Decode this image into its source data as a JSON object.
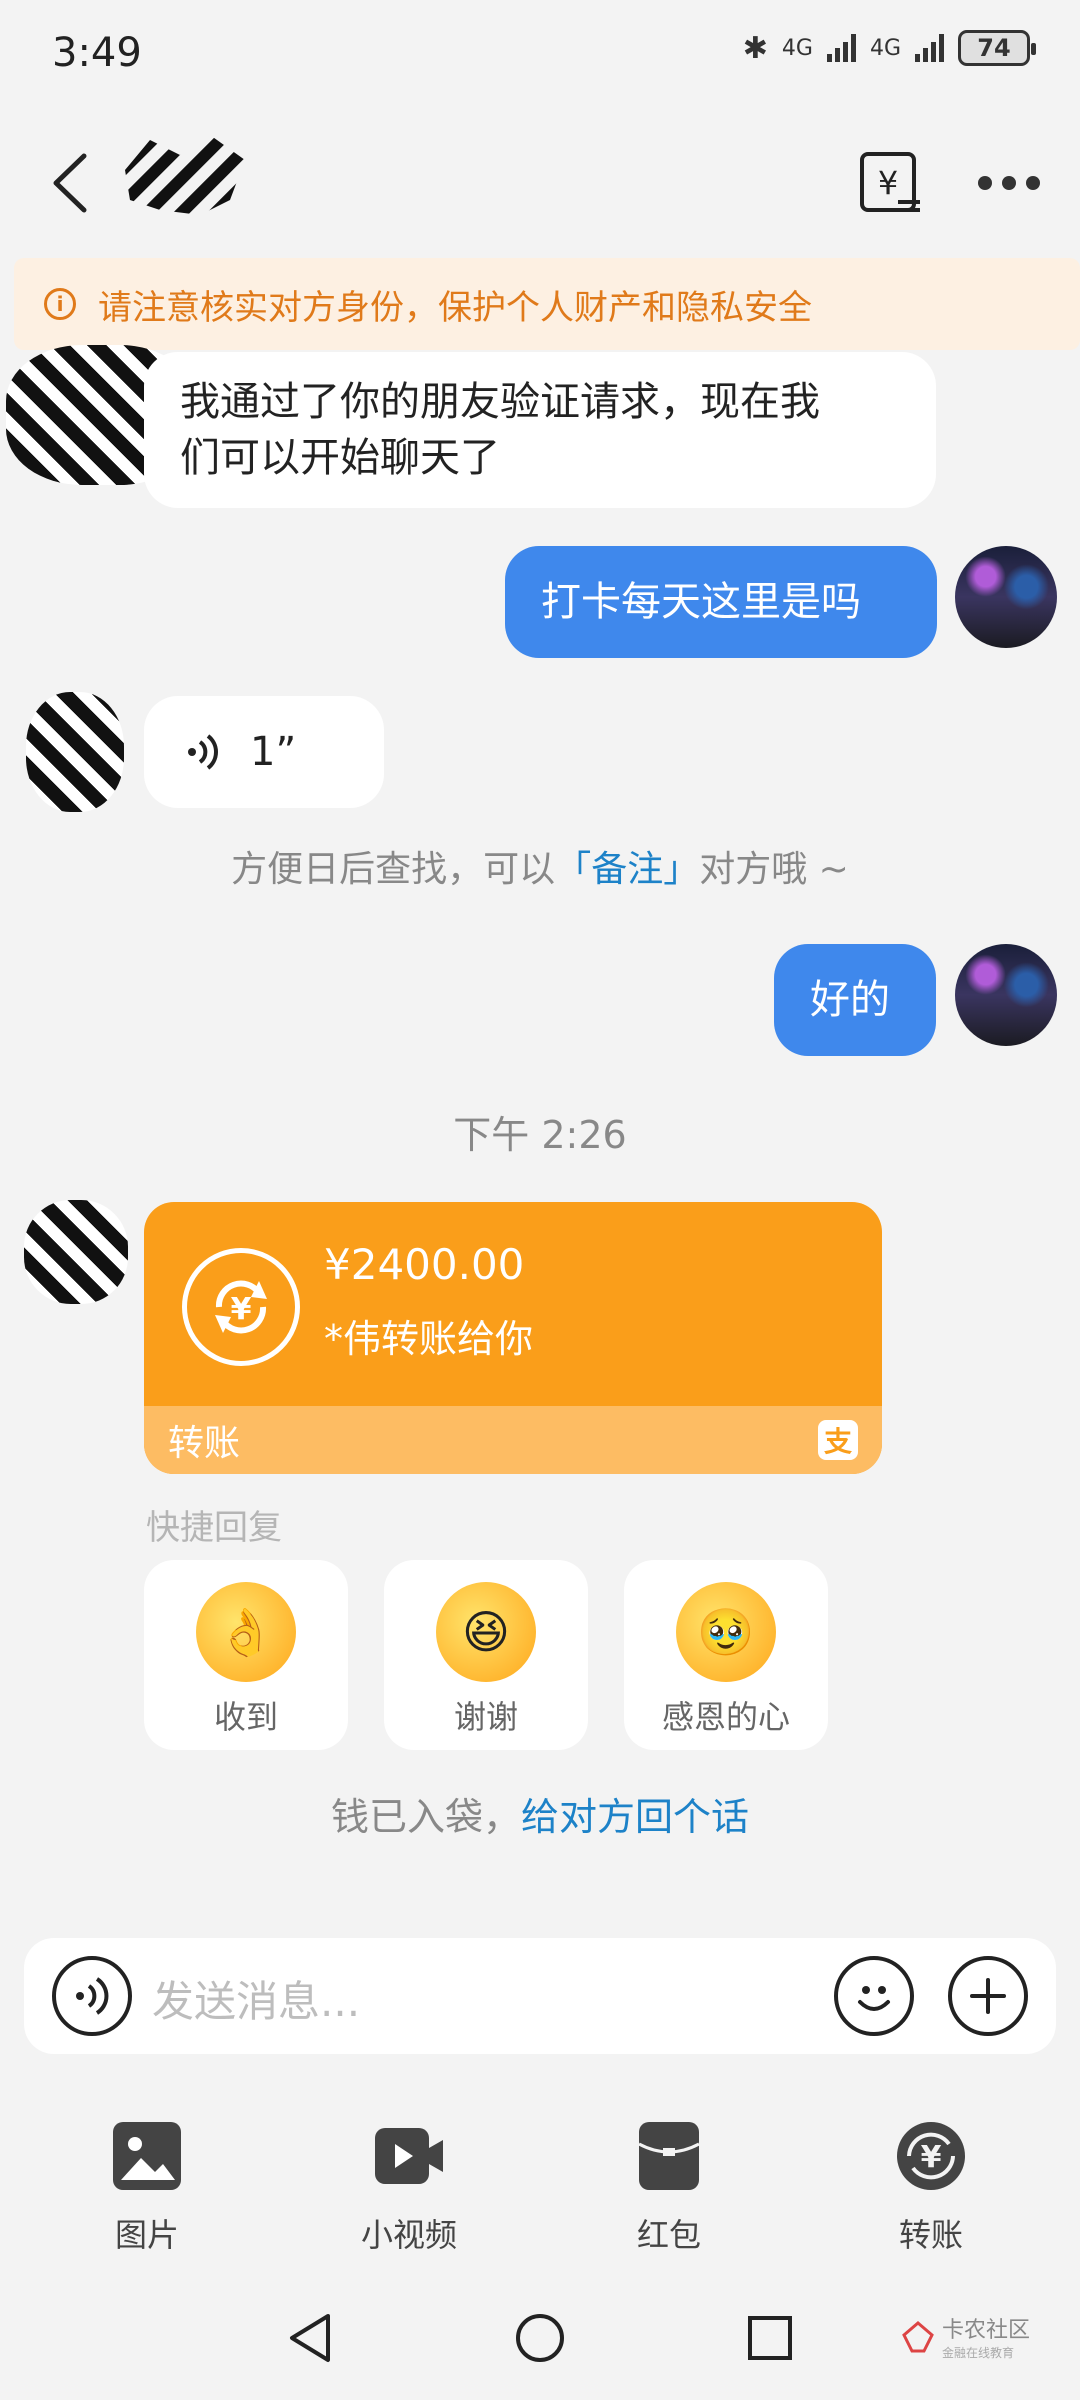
{
  "status_bar": {
    "time": "3:49",
    "network1": "4G",
    "network2": "4G",
    "battery": "74"
  },
  "header": {
    "contact_avatar": "masked-avatar"
  },
  "warning": {
    "text": "请注意核实对方身份，保护个人财产和隐私安全"
  },
  "messages": [
    {
      "side": "in",
      "text_line1": "我通过了你的朋友验证请求，现在我",
      "text_line2": "们可以开始聊天了"
    },
    {
      "side": "out",
      "text": "打卡每天这里是吗"
    },
    {
      "side": "in",
      "type": "voice",
      "duration": "1”"
    },
    {
      "side": "out",
      "text": "好的"
    }
  ],
  "system_note": {
    "prefix": "方便日后查找，可以",
    "highlight": "「备注」",
    "suffix": "对方哦 ~"
  },
  "timestamp": "下午 2:26",
  "transfer": {
    "amount": "¥2400.00",
    "from": "*伟转账给你",
    "footer": "转账"
  },
  "quick_reply": {
    "title": "快捷回复",
    "items": [
      {
        "label": "收到"
      },
      {
        "label": "谢谢"
      },
      {
        "label": "感恩的心"
      }
    ]
  },
  "received_note": {
    "prefix": "钱已入袋，",
    "link": "给对方回个话"
  },
  "input": {
    "placeholder": "发送消息..."
  },
  "tools": [
    {
      "label": "图片"
    },
    {
      "label": "小视频"
    },
    {
      "label": "红包"
    },
    {
      "label": "转账"
    }
  ],
  "watermark": {
    "title": "卡农社区",
    "subtitle": "金融在线教育"
  },
  "colors": {
    "accent_blue": "#3f88ec",
    "transfer_orange": "#fa9e1a",
    "warning_orange": "#e07a1a",
    "link_blue": "#1d82c8"
  }
}
